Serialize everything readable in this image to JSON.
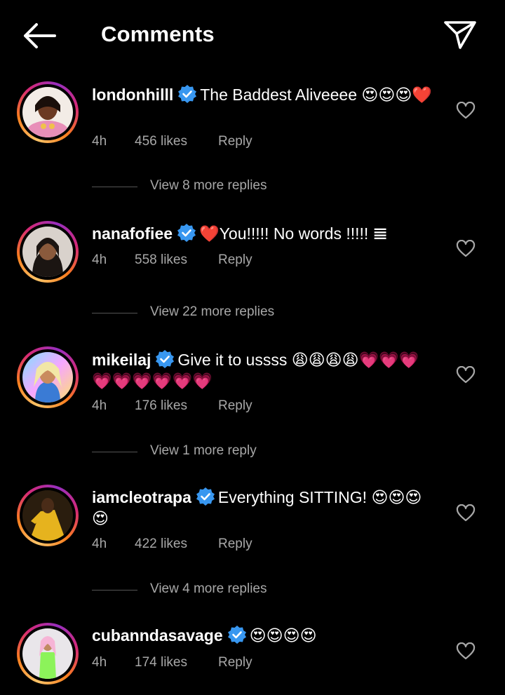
{
  "header": {
    "title": "Comments",
    "back_icon": "arrow-left-icon",
    "share_icon": "paper-plane-icon"
  },
  "comments": [
    {
      "username": "londonhilll",
      "text": "The Baddest Aliveeee 😍😍😍❤️",
      "time": "4h",
      "likes": "456 likes",
      "reply": "Reply",
      "view_replies": "View 8 more replies"
    },
    {
      "username": "nanafofiee",
      "text": "❤️You!!!!! No words !!!!! 𝌆",
      "time": "4h",
      "likes": "558 likes",
      "reply": "Reply",
      "view_replies": "View 22 more replies"
    },
    {
      "username": "mikeilaj",
      "text": "Give it to ussss 😩😩😩😩💗💗💗💗💗💗💗💗💗",
      "time": "4h",
      "likes": "176 likes",
      "reply": "Reply",
      "view_replies": "View 1 more reply"
    },
    {
      "username": "iamcleotrapa",
      "text": "Everything SITTING! 😍😍😍😍",
      "time": "4h",
      "likes": "422 likes",
      "reply": "Reply",
      "view_replies": "View 4 more replies"
    },
    {
      "username": "cubanndasavage",
      "text": "😍😍😍😍",
      "time": "4h",
      "likes": "174 likes",
      "reply": "Reply"
    }
  ],
  "colors": {
    "verified": "#3897f0",
    "muted": "#a8a8a8",
    "background": "#000000"
  }
}
